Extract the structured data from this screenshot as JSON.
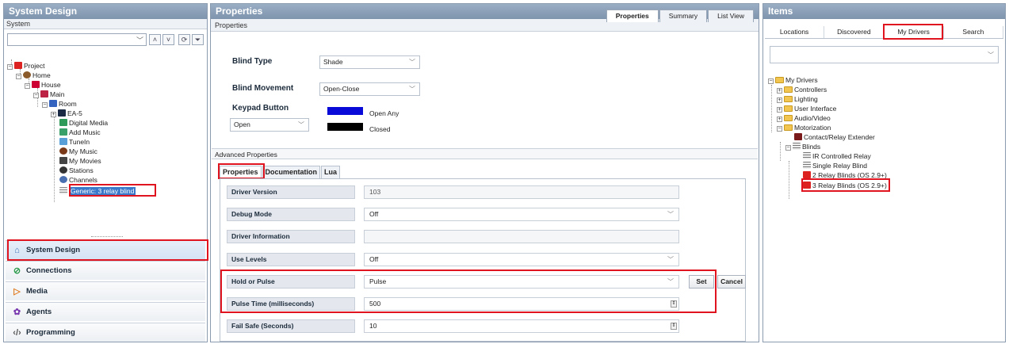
{
  "left": {
    "title": "System Design",
    "subheader": "System",
    "tree": [
      {
        "label": "Project"
      },
      {
        "label": "Home"
      },
      {
        "label": "House"
      },
      {
        "label": "Main"
      },
      {
        "label": "Room"
      },
      {
        "label": "EA-5"
      },
      {
        "label": "Digital Media"
      },
      {
        "label": "Add Music"
      },
      {
        "label": "TuneIn"
      },
      {
        "label": "My Music"
      },
      {
        "label": "My Movies"
      },
      {
        "label": "Stations"
      },
      {
        "label": "Channels"
      },
      {
        "label": "Generic: 3 relay blind"
      }
    ],
    "nav": [
      {
        "label": "System Design",
        "icon": "house-icon"
      },
      {
        "label": "Connections",
        "icon": "connections-icon"
      },
      {
        "label": "Media",
        "icon": "play-icon"
      },
      {
        "label": "Agents",
        "icon": "agents-icon"
      },
      {
        "label": "Programming",
        "icon": "code-icon"
      }
    ]
  },
  "center": {
    "title": "Properties",
    "tabs": [
      "Properties",
      "Summary",
      "List View"
    ],
    "subheader": "Properties",
    "blind_type_label": "Blind Type",
    "blind_type_value": "Shade",
    "blind_movement_label": "Blind Movement",
    "blind_movement_value": "Open-Close",
    "keypad_button_label": "Keypad Button",
    "keypad_button_value": "Open",
    "legend": [
      {
        "label": "Open Any",
        "color": "#0a0ad8"
      },
      {
        "label": "Closed",
        "color": "#000000"
      }
    ],
    "advanced_title": "Advanced Properties",
    "subtabs": [
      "Properties",
      "Documentation",
      "Lua"
    ],
    "props": [
      {
        "label": "Driver Version",
        "value": "103"
      },
      {
        "label": "Debug Mode",
        "value": "Off"
      },
      {
        "label": "Driver Information",
        "value": ""
      },
      {
        "label": "Use Levels",
        "value": "Off"
      },
      {
        "label": "Hold or Pulse",
        "value": "Pulse"
      },
      {
        "label": "Pulse Time (milliseconds)",
        "value": "500"
      },
      {
        "label": "Fail Safe (Seconds)",
        "value": "10"
      }
    ],
    "set_label": "Set",
    "cancel_label": "Cancel"
  },
  "right": {
    "title": "Items",
    "tabs": [
      "Locations",
      "Discovered",
      "My Drivers",
      "Search"
    ],
    "tree": [
      {
        "label": "My Drivers"
      },
      {
        "label": "Controllers"
      },
      {
        "label": "Lighting"
      },
      {
        "label": "User Interface"
      },
      {
        "label": "Audio/Video"
      },
      {
        "label": "Motorization"
      },
      {
        "label": "Contact/Relay Extender"
      },
      {
        "label": "Blinds"
      },
      {
        "label": "IR Controlled Relay"
      },
      {
        "label": "Single Relay Blind"
      },
      {
        "label": "2 Relay Blinds (OS 2.9+)"
      },
      {
        "label": "3 Relay Blinds (OS 2.9+)"
      }
    ]
  },
  "colors": {
    "accent_red": "#e0141e",
    "selection": "#3a79c9",
    "header": "#8ea3bb"
  }
}
